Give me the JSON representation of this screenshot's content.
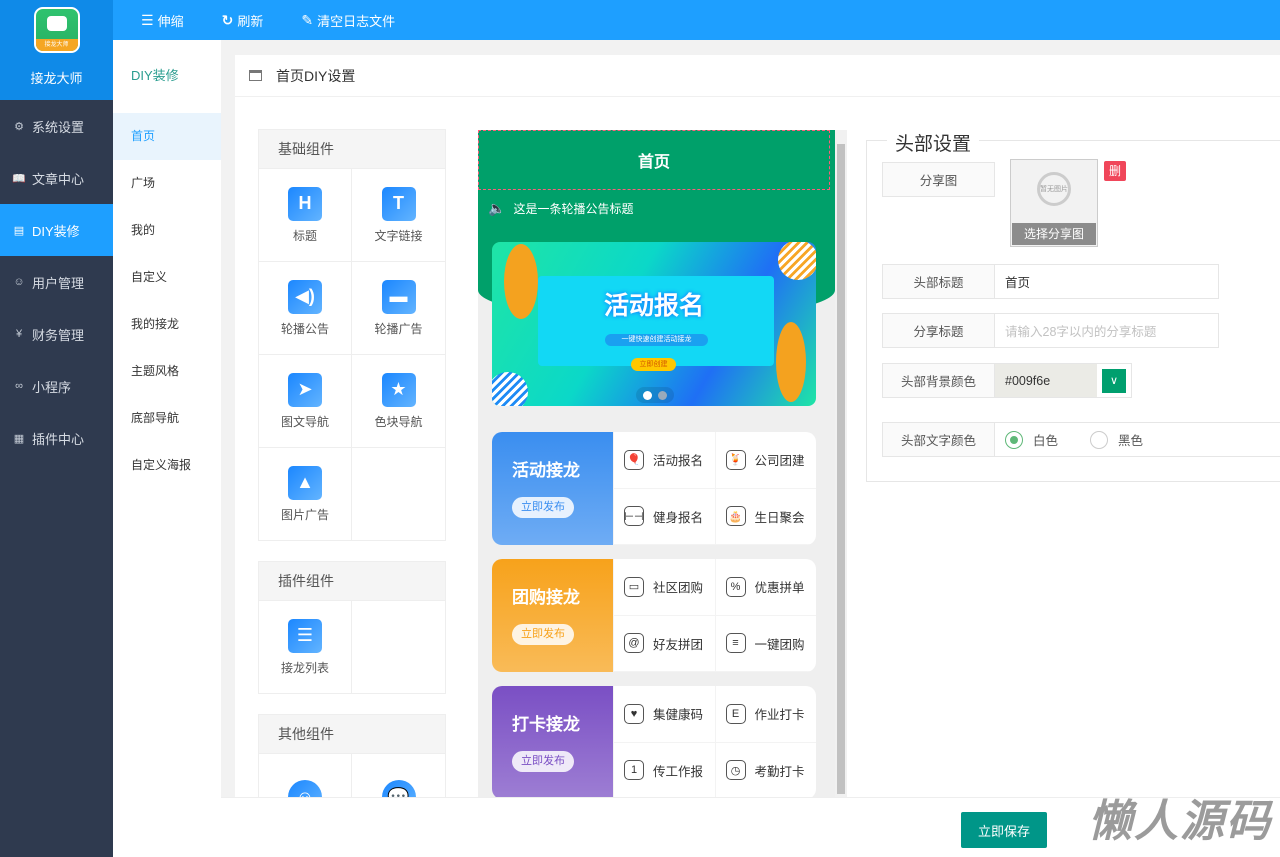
{
  "brand": {
    "name": "接龙大师",
    "logo_text": "接龙大师"
  },
  "sidebar": {
    "items": [
      {
        "label": "系统设置",
        "icon": "gear-icon"
      },
      {
        "label": "文章中心",
        "icon": "book-icon"
      },
      {
        "label": "DIY装修",
        "icon": "layout-icon"
      },
      {
        "label": "用户管理",
        "icon": "user-icon"
      },
      {
        "label": "财务管理",
        "icon": "yen-icon"
      },
      {
        "label": "小程序",
        "icon": "link-icon"
      },
      {
        "label": "插件中心",
        "icon": "grid-icon"
      }
    ]
  },
  "topbar": {
    "collapse": "伸缩",
    "refresh": "刷新",
    "clear_logs": "清空日志文件"
  },
  "submenu": {
    "title": "DIY装修",
    "items": [
      "首页",
      "广场",
      "我的",
      "自定义",
      "我的接龙",
      "主题风格",
      "底部导航",
      "自定义海报"
    ]
  },
  "page": {
    "title": "首页DIY设置"
  },
  "components": {
    "basic": {
      "title": "基础组件",
      "items": [
        {
          "label": "标题",
          "glyph": "H"
        },
        {
          "label": "文字链接",
          "glyph": "T"
        },
        {
          "label": "轮播公告",
          "glyph": "◀)"
        },
        {
          "label": "轮播广告",
          "glyph": "▬"
        },
        {
          "label": "图文导航",
          "glyph": "➤"
        },
        {
          "label": "色块导航",
          "glyph": "★"
        },
        {
          "label": "图片广告",
          "glyph": "▲"
        }
      ]
    },
    "plugin": {
      "title": "插件组件",
      "items": [
        {
          "label": "接龙列表",
          "glyph": "☰"
        }
      ]
    },
    "other": {
      "title": "其他组件"
    }
  },
  "preview": {
    "header_title": "首页",
    "notice": "这是一条轮播公告标题",
    "banner": {
      "title": "活动报名",
      "subtitle": "一键快速创建活动接龙",
      "button": "立即创建"
    },
    "categories": [
      {
        "title": "活动接龙",
        "button": "立即发布",
        "color": "#3a8ef0",
        "items": [
          "活动报名",
          "公司团建",
          "健身报名",
          "生日聚会"
        ],
        "glyphs": [
          "🎈",
          "🍹",
          "⊢⊣",
          "🎂"
        ]
      },
      {
        "title": "团购接龙",
        "button": "立即发布",
        "color": "#f7a21b",
        "items": [
          "社区团购",
          "优惠拼单",
          "好友拼团",
          "一键团购"
        ],
        "glyphs": [
          "▭",
          "%",
          "@",
          "≡"
        ]
      },
      {
        "title": "打卡接龙",
        "button": "立即发布",
        "color": "#7a4fc4",
        "items": [
          "集健康码",
          "作业打卡",
          "传工作报",
          "考勤打卡"
        ],
        "glyphs": [
          "♥",
          "E",
          "1",
          "◷"
        ]
      }
    ]
  },
  "settings": {
    "legend": "头部设置",
    "share_image_label": "分享图",
    "no_image": "暂无图片",
    "choose_share_image": "选择分享图",
    "delete_image": "删除图片",
    "header_title_label": "头部标题",
    "header_title_value": "首页",
    "share_title_label": "分享标题",
    "share_title_placeholder": "请输入28字以内的分享标题",
    "bg_color_label": "头部背景颜色",
    "bg_color_value": "#009f6e",
    "text_color_label": "头部文字颜色",
    "text_color_options": [
      "白色",
      "黑色"
    ],
    "text_color_selected": "白色"
  },
  "footer": {
    "save": "立即保存"
  },
  "watermark": "懒人源码"
}
